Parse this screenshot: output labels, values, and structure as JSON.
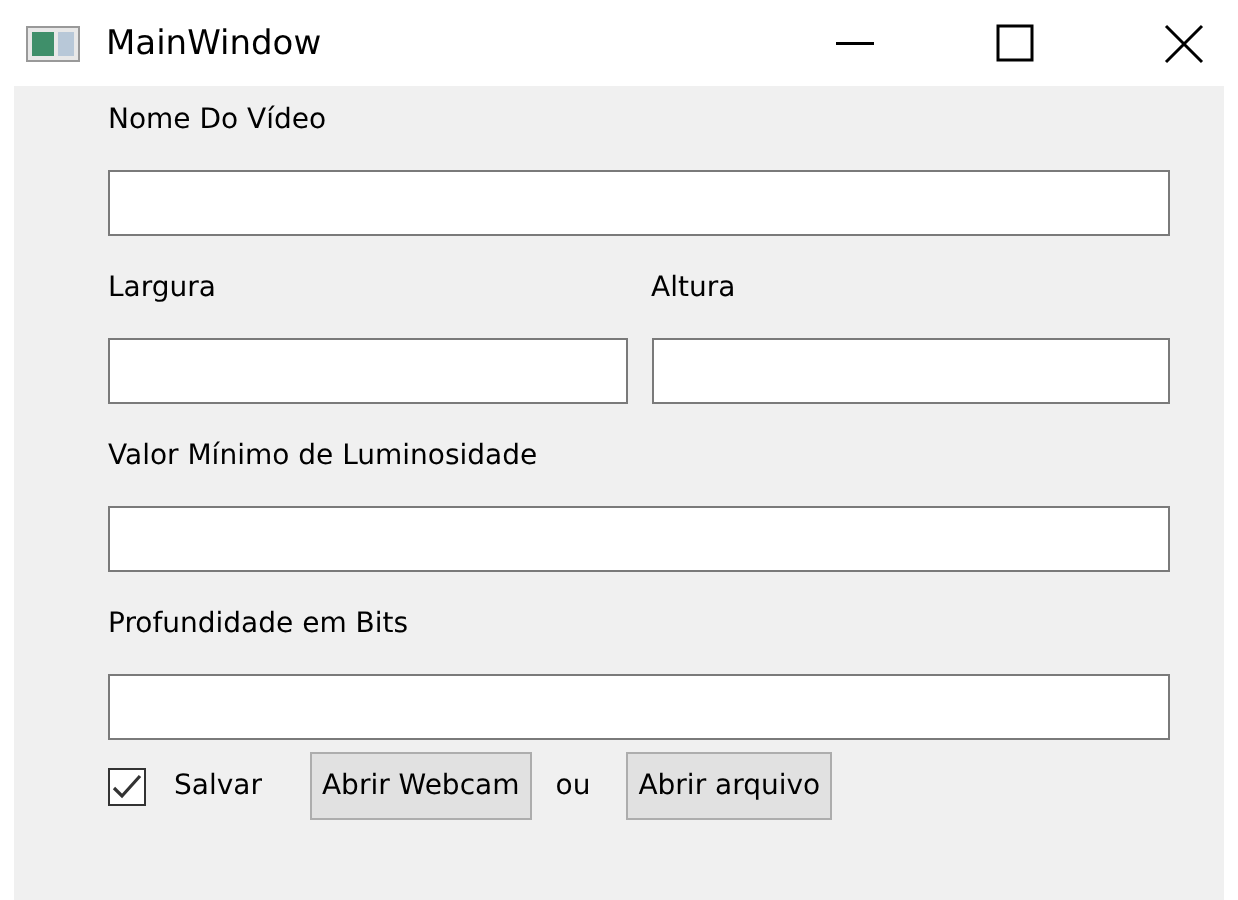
{
  "window": {
    "title": "MainWindow"
  },
  "rows": [
    [
      {
        "label": "Nome Do Vídeo"
      }
    ],
    [
      {
        "label": "Largura"
      },
      {
        "label": "Altura"
      }
    ],
    [
      {
        "label": "Valor Mínimo de Luminosidade"
      }
    ],
    [
      {
        "label": "Profundidade em Bits"
      }
    ]
  ],
  "actions": [
    {
      "kind": "checkbox",
      "label": "Salvar",
      "checked": true
    },
    {
      "kind": "button",
      "label": "Abrir Webcam"
    },
    {
      "kind": "text",
      "label": "ou"
    },
    {
      "kind": "button",
      "label": "Abrir arquivo"
    }
  ]
}
